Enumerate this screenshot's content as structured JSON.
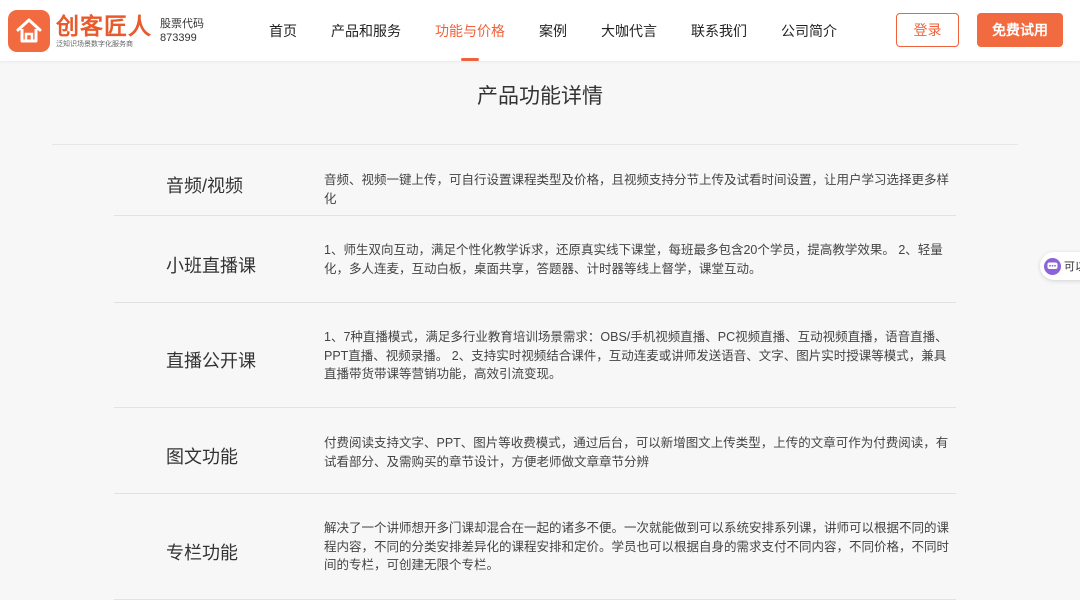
{
  "header": {
    "brand_name": "创客匠人",
    "brand_slogan": "泛知识场景数字化服务商",
    "stock_label": "股票代码",
    "stock_code": "873399",
    "nav": [
      "首页",
      "产品和服务",
      "功能与价格",
      "案例",
      "大咖代言",
      "联系我们",
      "公司简介"
    ],
    "active_nav": "功能与价格",
    "login_label": "登录",
    "trial_label": "免费试用"
  },
  "main": {
    "title": "产品功能详情",
    "features": [
      {
        "name": "音频/视频",
        "desc": "音频、视频一键上传，可自行设置课程类型及价格，且视频支持分节上传及试看时间设置，让用户学习选择更多样化"
      },
      {
        "name": "小班直播课",
        "desc": "1、师生双向互动，满足个性化教学诉求，还原真实线下课堂，每班最多包含20个学员，提高教学效果。 2、轻量化，多人连麦，互动白板，桌面共享，答题器、计时器等线上督学，课堂互动。"
      },
      {
        "name": "直播公开课",
        "desc": "1、7种直播模式，满足多行业教育培训场景需求：OBS/手机视频直播、PC视频直播、互动视频直播，语音直播、PPT直播、视频录播。 2、支持实时视频结合课件，互动连麦或讲师发送语音、文字、图片实时授课等模式，兼具直播带货带课等营销功能，高效引流变现。"
      },
      {
        "name": "图文功能",
        "desc": "付费阅读支持文字、PPT、图片等收费模式，通过后台，可以新增图文上传类型，上传的文章可作为付费阅读，有试看部分、及需购买的章节设计，方便老师做文章章节分辨"
      },
      {
        "name": "专栏功能",
        "desc": "解决了一个讲师想开多门课却混合在一起的诸多不便。一次就能做到可以系统安排系列课，讲师可以根据不同的课程内容，不同的分类安排差异化的课程安排和定价。学员也可以根据自身的需求支付不同内容，不同价格，不同时间的专栏，可创建无限个专栏。"
      }
    ]
  },
  "side_chat": {
    "label": "可以"
  },
  "colors": {
    "accent": "#f26a3f",
    "chat": "#8c63d8",
    "background": "#f7f7f7"
  }
}
